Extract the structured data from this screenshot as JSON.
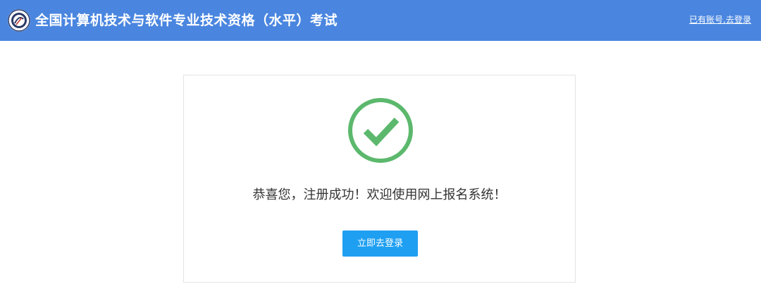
{
  "header": {
    "title": "全国计算机技术与软件专业技术资格（水平）考试",
    "login_link": "已有账号,去登录",
    "logo_icon": "exam-logo-icon"
  },
  "main": {
    "success_icon": "check-circle-icon",
    "message": "恭喜您，注册成功！欢迎使用网上报名系统！",
    "login_button": "立即去登录"
  },
  "colors": {
    "header_bg": "#4a86e0",
    "success_green": "#5cb86d",
    "button_blue": "#1e9ff2"
  }
}
